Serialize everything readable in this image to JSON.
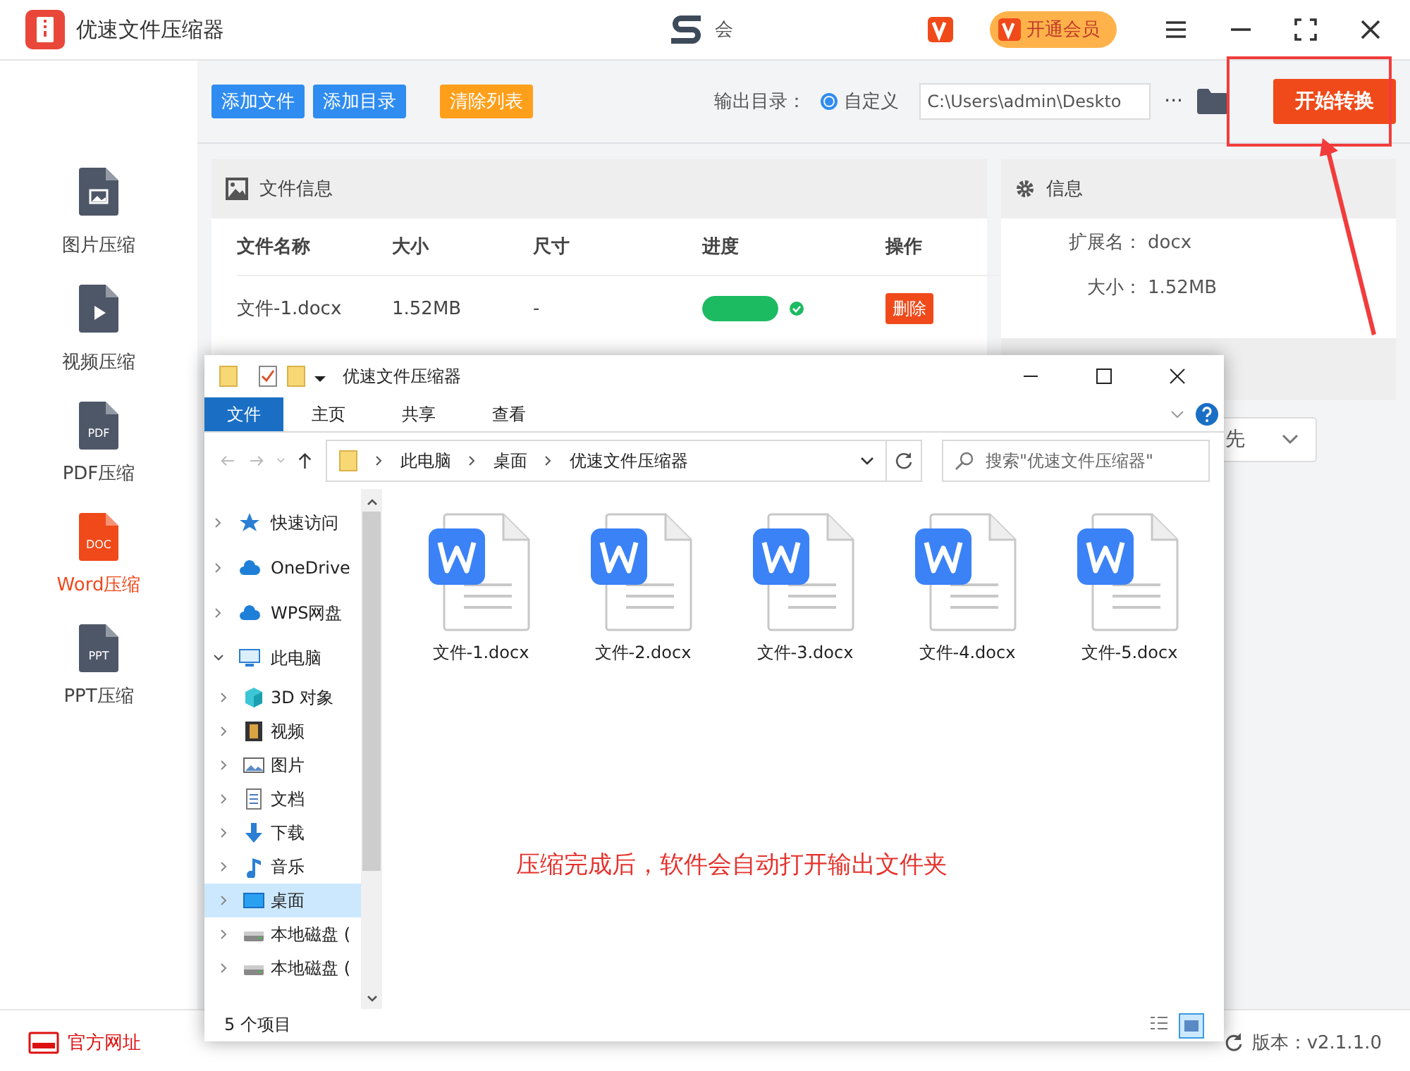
{
  "app": {
    "title": "优速文件压缩器",
    "logo_text": "会",
    "vip_button": "开通会员"
  },
  "toolbar": {
    "buttons": [
      {
        "label": "添加文件",
        "kind": "primary"
      },
      {
        "label": "添加目录",
        "kind": "primary"
      },
      {
        "label": "清除列表",
        "kind": "warning"
      }
    ],
    "output_label": "输出目录：",
    "radio": {
      "label": "自定义",
      "selected": true
    },
    "path_value": "C:\\Users\\admin\\Deskto",
    "more": "···",
    "start_button": "开始转换"
  },
  "sidebar": {
    "items": [
      {
        "label": "图片压缩",
        "kind": "image",
        "selected": false
      },
      {
        "label": "视频压缩",
        "kind": "video",
        "selected": false
      },
      {
        "label": "PDF压缩",
        "kind": "text",
        "icon_text": "PDF",
        "selected": false
      },
      {
        "label": "Word压缩",
        "kind": "text",
        "icon_text": "DOC",
        "selected": true
      },
      {
        "label": "PPT压缩",
        "kind": "text",
        "icon_text": "PPT",
        "selected": false
      }
    ]
  },
  "file_panel": {
    "title": "文件信息",
    "columns": [
      "文件名称",
      "大小",
      "尺寸",
      "进度",
      "操作"
    ],
    "rows": [
      {
        "name": "文件-1.docx",
        "size": "1.52MB",
        "dimensions": "-",
        "level": 1,
        "done": true,
        "action": "删除"
      }
    ]
  },
  "info_panel": {
    "title": "信息",
    "fields": [
      {
        "label": "扩展名：",
        "value": "docx"
      },
      {
        "label": "大小：",
        "value": "1.52MB"
      }
    ],
    "select_value": "先"
  },
  "footer": {
    "links": [
      {
        "label": "官方网址",
        "kind": "web"
      }
    ],
    "version": "版本：v2.1.1.0"
  },
  "explorer": {
    "title": "优速文件压缩器",
    "ribbon_tabs": [
      {
        "label": "文件",
        "selected": true
      },
      {
        "label": "主页",
        "selected": false
      },
      {
        "label": "共享",
        "selected": false
      },
      {
        "label": "查看",
        "selected": false
      }
    ],
    "breadcrumb": [
      "此电脑",
      "桌面",
      "优速文件压缩器"
    ],
    "search_placeholder": "搜索\"优速文件压缩器\"",
    "nav": [
      {
        "label": "快速访问",
        "kind": "star",
        "expanded": false,
        "selected": false
      },
      {
        "label": "OneDrive",
        "kind": "cloud",
        "expanded": false,
        "selected": false
      },
      {
        "label": "WPS网盘",
        "kind": "cloud",
        "expanded": false,
        "selected": false
      },
      {
        "label": "此电脑",
        "kind": "pc",
        "expanded": true,
        "selected": false,
        "children": [
          {
            "label": "3D 对象",
            "kind": "cube",
            "expanded": false,
            "selected": false
          },
          {
            "label": "视频",
            "kind": "film",
            "expanded": false,
            "selected": false
          },
          {
            "label": "图片",
            "kind": "image",
            "expanded": false,
            "selected": false
          },
          {
            "label": "文档",
            "kind": "doc",
            "expanded": false,
            "selected": false
          },
          {
            "label": "下载",
            "kind": "download",
            "expanded": false,
            "selected": false
          },
          {
            "label": "音乐",
            "kind": "music",
            "expanded": false,
            "selected": false
          },
          {
            "label": "桌面",
            "kind": "desktop",
            "expanded": false,
            "selected": true
          },
          {
            "label": "本地磁盘 (",
            "kind": "drive",
            "expanded": false,
            "selected": false
          },
          {
            "label": "本地磁盘 (",
            "kind": "drive",
            "expanded": false,
            "selected": false
          }
        ]
      }
    ],
    "files": [
      {
        "name": "文件-1.docx"
      },
      {
        "name": "文件-2.docx"
      },
      {
        "name": "文件-3.docx"
      },
      {
        "name": "文件-4.docx"
      },
      {
        "name": "文件-5.docx"
      }
    ],
    "status": "5 个项目",
    "annotation": "压缩完成后，软件会自动打开输出文件夹"
  }
}
